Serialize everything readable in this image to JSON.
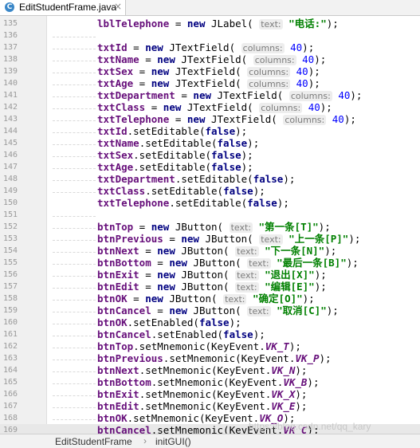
{
  "tab": {
    "title": "EditStudentFrame.java",
    "icon": "java-class-icon",
    "close_glyph": "×"
  },
  "status": {
    "breadcrumb_file": "EditStudentFrame",
    "breadcrumb_sep": "›",
    "breadcrumb_method": "initGUI()"
  },
  "watermark": "https://blog.csdn.net/qq_kary",
  "current_line": 169,
  "colors": {
    "field": "#660e7a",
    "keyword": "#000080",
    "string": "#008000",
    "number": "#0000ff"
  },
  "lines": [
    {
      "n": 135,
      "t": [
        [
          "lblTelephone",
          "f"
        ],
        " = ",
        [
          "new",
          "k"
        ],
        " JLabel( ",
        [
          "text:",
          "h"
        ],
        " ",
        [
          "\"电话:\"",
          "s"
        ],
        ");"
      ]
    },
    {
      "n": 136,
      "t": []
    },
    {
      "n": 137,
      "t": [
        [
          "txtId",
          "f"
        ],
        " = ",
        [
          "new",
          "k"
        ],
        " JTextField( ",
        [
          "columns:",
          "h"
        ],
        " ",
        [
          "40",
          "n"
        ],
        ");"
      ]
    },
    {
      "n": 138,
      "t": [
        [
          "txtName",
          "f"
        ],
        " = ",
        [
          "new",
          "k"
        ],
        " JTextField( ",
        [
          "columns:",
          "h"
        ],
        " ",
        [
          "40",
          "n"
        ],
        ");"
      ]
    },
    {
      "n": 139,
      "t": [
        [
          "txtSex",
          "f"
        ],
        " = ",
        [
          "new",
          "k"
        ],
        " JTextField( ",
        [
          "columns:",
          "h"
        ],
        " ",
        [
          "40",
          "n"
        ],
        ");"
      ]
    },
    {
      "n": 140,
      "t": [
        [
          "txtAge",
          "f"
        ],
        " = ",
        [
          "new",
          "k"
        ],
        " JTextField( ",
        [
          "columns:",
          "h"
        ],
        " ",
        [
          "40",
          "n"
        ],
        ");"
      ]
    },
    {
      "n": 141,
      "t": [
        [
          "txtDepartment",
          "f"
        ],
        " = ",
        [
          "new",
          "k"
        ],
        " JTextField( ",
        [
          "columns:",
          "h"
        ],
        " ",
        [
          "40",
          "n"
        ],
        ");"
      ]
    },
    {
      "n": 142,
      "t": [
        [
          "txtClass",
          "f"
        ],
        " = ",
        [
          "new",
          "k"
        ],
        " JTextField( ",
        [
          "columns:",
          "h"
        ],
        " ",
        [
          "40",
          "n"
        ],
        ");"
      ]
    },
    {
      "n": 143,
      "t": [
        [
          "txtTelephone",
          "f"
        ],
        " = ",
        [
          "new",
          "k"
        ],
        " JTextField( ",
        [
          "columns:",
          "h"
        ],
        " ",
        [
          "40",
          "n"
        ],
        ");"
      ]
    },
    {
      "n": 144,
      "t": [
        [
          "txtId",
          "f"
        ],
        ".setEditable(",
        [
          "false",
          "k"
        ],
        ");"
      ]
    },
    {
      "n": 145,
      "t": [
        [
          "txtName",
          "f"
        ],
        ".setEditable(",
        [
          "false",
          "k"
        ],
        ");"
      ]
    },
    {
      "n": 146,
      "t": [
        [
          "txtSex",
          "f"
        ],
        ".setEditable(",
        [
          "false",
          "k"
        ],
        ");"
      ]
    },
    {
      "n": 147,
      "t": [
        [
          "txtAge",
          "f"
        ],
        ".setEditable(",
        [
          "false",
          "k"
        ],
        ");"
      ]
    },
    {
      "n": 148,
      "t": [
        [
          "txtDepartment",
          "f"
        ],
        ".setEditable(",
        [
          "false",
          "k"
        ],
        ");"
      ]
    },
    {
      "n": 149,
      "t": [
        [
          "txtClass",
          "f"
        ],
        ".setEditable(",
        [
          "false",
          "k"
        ],
        ");"
      ]
    },
    {
      "n": 150,
      "t": [
        [
          "txtTelephone",
          "f"
        ],
        ".setEditable(",
        [
          "false",
          "k"
        ],
        ");"
      ]
    },
    {
      "n": 151,
      "t": []
    },
    {
      "n": 152,
      "t": [
        [
          "btnTop",
          "f"
        ],
        " = ",
        [
          "new",
          "k"
        ],
        " JButton( ",
        [
          "text:",
          "h"
        ],
        " ",
        [
          "\"第一条[T]\"",
          "s"
        ],
        ");"
      ]
    },
    {
      "n": 153,
      "t": [
        [
          "btnPrevious",
          "f"
        ],
        " = ",
        [
          "new",
          "k"
        ],
        " JButton( ",
        [
          "text:",
          "h"
        ],
        " ",
        [
          "\"上一条[P]\"",
          "s"
        ],
        ");"
      ]
    },
    {
      "n": 154,
      "t": [
        [
          "btnNext",
          "f"
        ],
        " = ",
        [
          "new",
          "k"
        ],
        " JButton( ",
        [
          "text:",
          "h"
        ],
        " ",
        [
          "\"下一条[N]\"",
          "s"
        ],
        ");"
      ]
    },
    {
      "n": 155,
      "t": [
        [
          "btnBottom",
          "f"
        ],
        " = ",
        [
          "new",
          "k"
        ],
        " JButton( ",
        [
          "text:",
          "h"
        ],
        " ",
        [
          "\"最后一条[B]\"",
          "s"
        ],
        ");"
      ]
    },
    {
      "n": 156,
      "t": [
        [
          "btnExit",
          "f"
        ],
        " = ",
        [
          "new",
          "k"
        ],
        " JButton( ",
        [
          "text:",
          "h"
        ],
        " ",
        [
          "\"退出[X]\"",
          "s"
        ],
        ");"
      ]
    },
    {
      "n": 157,
      "t": [
        [
          "btnEdit",
          "f"
        ],
        " = ",
        [
          "new",
          "k"
        ],
        " JButton( ",
        [
          "text:",
          "h"
        ],
        " ",
        [
          "\"编辑[E]\"",
          "s"
        ],
        ");"
      ]
    },
    {
      "n": 158,
      "t": [
        [
          "btnOK",
          "f"
        ],
        " = ",
        [
          "new",
          "k"
        ],
        " JButton( ",
        [
          "text:",
          "h"
        ],
        " ",
        [
          "\"确定[O]\"",
          "s"
        ],
        ");"
      ]
    },
    {
      "n": 159,
      "t": [
        [
          "btnCancel",
          "f"
        ],
        " = ",
        [
          "new",
          "k"
        ],
        " JButton( ",
        [
          "text:",
          "h"
        ],
        " ",
        [
          "\"取消[C]\"",
          "s"
        ],
        ");"
      ]
    },
    {
      "n": 160,
      "t": [
        [
          "btnOK",
          "f"
        ],
        ".setEnabled(",
        [
          "false",
          "k"
        ],
        ");"
      ]
    },
    {
      "n": 161,
      "t": [
        [
          "btnCancel",
          "f"
        ],
        ".setEnabled(",
        [
          "false",
          "k"
        ],
        ");"
      ]
    },
    {
      "n": 162,
      "t": [
        [
          "btnTop",
          "f"
        ],
        ".setMnemonic(KeyEvent.",
        [
          "VK_T",
          "i"
        ],
        ");"
      ]
    },
    {
      "n": 163,
      "t": [
        [
          "btnPrevious",
          "f"
        ],
        ".setMnemonic(KeyEvent.",
        [
          "VK_P",
          "i"
        ],
        ");"
      ]
    },
    {
      "n": 164,
      "t": [
        [
          "btnNext",
          "f"
        ],
        ".setMnemonic(KeyEvent.",
        [
          "VK_N",
          "i"
        ],
        ");"
      ]
    },
    {
      "n": 165,
      "t": [
        [
          "btnBottom",
          "f"
        ],
        ".setMnemonic(KeyEvent.",
        [
          "VK_B",
          "i"
        ],
        ");"
      ]
    },
    {
      "n": 166,
      "t": [
        [
          "btnExit",
          "f"
        ],
        ".setMnemonic(KeyEvent.",
        [
          "VK_X",
          "i"
        ],
        ");"
      ]
    },
    {
      "n": 167,
      "t": [
        [
          "btnEdit",
          "f"
        ],
        ".setMnemonic(KeyEvent.",
        [
          "VK_E",
          "i"
        ],
        ");"
      ]
    },
    {
      "n": 168,
      "t": [
        [
          "btnOK",
          "f"
        ],
        ".setMnemonic(KeyEvent.",
        [
          "VK_O",
          "i"
        ],
        ");"
      ]
    },
    {
      "n": 169,
      "t": [
        [
          "btnCancel",
          "f"
        ],
        ".setMnemonic(KeyEvent.",
        [
          "VK_C",
          "i"
        ],
        ");"
      ]
    }
  ]
}
